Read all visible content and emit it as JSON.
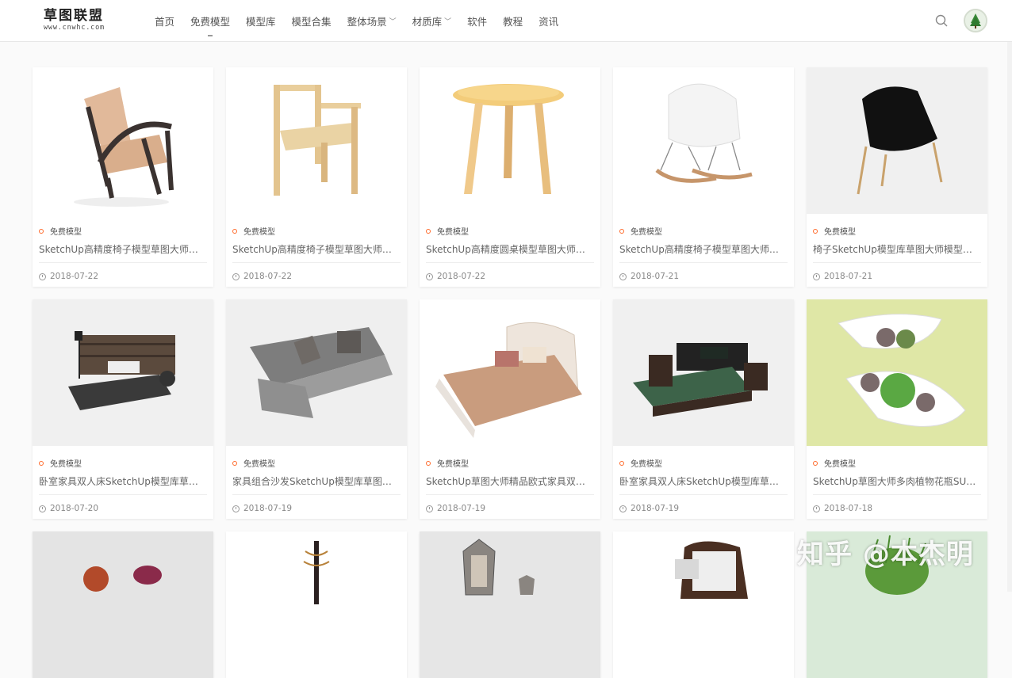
{
  "site": {
    "logo_main": "草图联盟",
    "logo_sub": "www.cnwhc.com"
  },
  "nav": [
    {
      "label": "首页",
      "dropdown": false,
      "active": false
    },
    {
      "label": "免费模型",
      "dropdown": false,
      "active": true
    },
    {
      "label": "模型库",
      "dropdown": false,
      "active": false
    },
    {
      "label": "模型合集",
      "dropdown": false,
      "active": false
    },
    {
      "label": "整体场景",
      "dropdown": true,
      "active": false
    },
    {
      "label": "材质库",
      "dropdown": true,
      "active": false
    },
    {
      "label": "软件",
      "dropdown": false,
      "active": false
    },
    {
      "label": "教程",
      "dropdown": false,
      "active": false
    },
    {
      "label": "资讯",
      "dropdown": false,
      "active": false
    }
  ],
  "icons": {
    "search": "search-icon",
    "avatar": "tree-avatar-icon"
  },
  "colors": {
    "category_dot": "#ff6b2c",
    "card_bg": "#ffffff",
    "page_bg": "#fafafa"
  },
  "cards": [
    {
      "thumb": "armchair",
      "category": "免费模型",
      "title": "SketchUp高精度椅子模型草图大师椅子模型下载",
      "date": "2018-07-22"
    },
    {
      "thumb": "wood-chair",
      "category": "免费模型",
      "title": "SketchUp高精度椅子模型草图大师椅子模型下载",
      "date": "2018-07-22"
    },
    {
      "thumb": "round-table",
      "category": "免费模型",
      "title": "SketchUp高精度圆桌模型草图大师椅子模型下载",
      "date": "2018-07-22"
    },
    {
      "thumb": "rocking-chair",
      "category": "免费模型",
      "title": "SketchUp高精度椅子模型草图大师椅子模型下载",
      "date": "2018-07-21"
    },
    {
      "thumb": "black-lounge-chair",
      "category": "免费模型",
      "title": "椅子SketchUp模型库草图大师模型下载",
      "date": "2018-07-21"
    },
    {
      "thumb": "dark-bed",
      "category": "免费模型",
      "title": "卧室家具双人床SketchUp模型库草图大师模型下载",
      "date": "2018-07-20"
    },
    {
      "thumb": "grey-sofa",
      "category": "免费模型",
      "title": "家具组合沙发SketchUp模型库草图大师模型下载",
      "date": "2018-07-19"
    },
    {
      "thumb": "european-bed",
      "category": "免费模型",
      "title": "SketchUp草图大师精品欧式家具双人床模型下载",
      "date": "2018-07-19"
    },
    {
      "thumb": "green-bed",
      "category": "免费模型",
      "title": "卧室家具双人床SketchUp模型库草图大师模型下载",
      "date": "2018-07-19"
    },
    {
      "thumb": "succulent-planter",
      "category": "免费模型",
      "title": "SketchUp草图大师多肉植物花瓶SU模型下载",
      "date": "2018-07-18"
    },
    {
      "thumb": "onions",
      "category": "",
      "title": "",
      "date": ""
    },
    {
      "thumb": "coat-rack",
      "category": "",
      "title": "",
      "date": ""
    },
    {
      "thumb": "lanterns",
      "category": "",
      "title": "",
      "date": ""
    },
    {
      "thumb": "baroque-chair",
      "category": "",
      "title": "",
      "date": ""
    },
    {
      "thumb": "grass-pot",
      "category": "",
      "title": "",
      "date": ""
    }
  ],
  "watermark": "知乎 @本杰明"
}
